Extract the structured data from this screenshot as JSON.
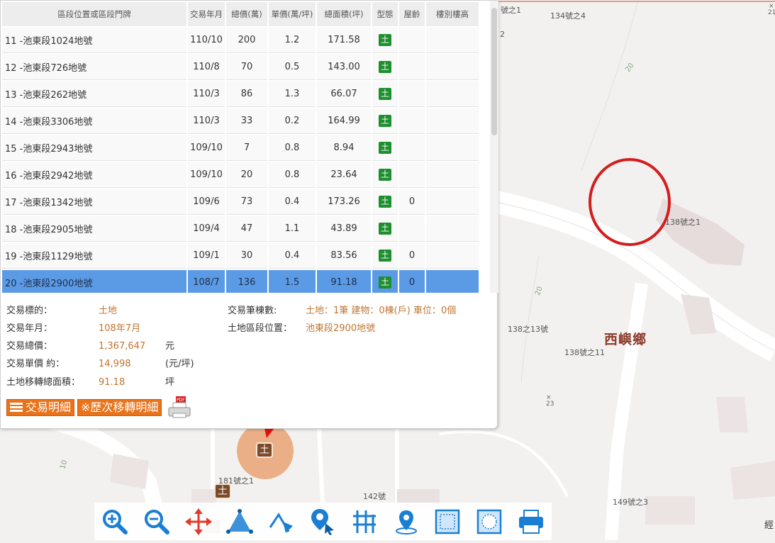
{
  "columns": {
    "address": "區段位置或區段門牌",
    "date": "交易年月",
    "total": "總價(萬)",
    "unit": "單價(萬/坪)",
    "area": "總面積(坪)",
    "type": "型態",
    "age": "屋齡",
    "floor": "樓別樓高"
  },
  "rows": [
    {
      "address": "11 -池東段1024地號",
      "date": "110/10",
      "total": "200",
      "unit": "1.2",
      "area": "171.58",
      "type": "土",
      "age": ""
    },
    {
      "address": "12 -池東段726地號",
      "date": "110/8",
      "total": "70",
      "unit": "0.5",
      "area": "143.00",
      "type": "土",
      "age": ""
    },
    {
      "address": "13 -池東段262地號",
      "date": "110/3",
      "total": "86",
      "unit": "1.3",
      "area": "66.07",
      "type": "土",
      "age": ""
    },
    {
      "address": "14 -池東段3306地號",
      "date": "110/3",
      "total": "33",
      "unit": "0.2",
      "area": "164.99",
      "type": "土",
      "age": ""
    },
    {
      "address": "15 -池東段2943地號",
      "date": "109/10",
      "total": "7",
      "unit": "0.8",
      "area": "8.94",
      "type": "土",
      "age": ""
    },
    {
      "address": "16 -池東段2942地號",
      "date": "109/10",
      "total": "20",
      "unit": "0.8",
      "area": "23.64",
      "type": "土",
      "age": ""
    },
    {
      "address": "17 -池東段1342地號",
      "date": "109/6",
      "total": "73",
      "unit": "0.4",
      "area": "173.26",
      "type": "土",
      "age": "0"
    },
    {
      "address": "18 -池東段2905地號",
      "date": "109/4",
      "total": "47",
      "unit": "1.1",
      "area": "43.89",
      "type": "土",
      "age": ""
    },
    {
      "address": "19 -池東段1129地號",
      "date": "109/1",
      "total": "30",
      "unit": "0.4",
      "area": "83.56",
      "type": "土",
      "age": "0"
    },
    {
      "address": "20 -池東段2900地號",
      "date": "108/7",
      "total": "136",
      "unit": "1.5",
      "area": "91.18",
      "type": "土",
      "age": "0"
    }
  ],
  "detail": {
    "target_label": "交易標的：",
    "target_value": "土地",
    "date_label": "交易年月：",
    "date_value": "108年7月",
    "total_label": "交易總價：",
    "total_value": "1,367,647",
    "total_unit": "元",
    "unit_label": "交易單價 約：",
    "unit_value": "14,998",
    "unit_unit": "(元/坪)",
    "area_label": "土地移轉總面積：",
    "area_value": "91.18",
    "area_unit": "坪",
    "count_label": "交易筆棟數:",
    "count_value": "土地：1筆 建物：0棟(戶) 車位：0個",
    "location_label": "土地區段位置：",
    "location_value": "池東段2900地號"
  },
  "actions": {
    "detail_button": "交易明細",
    "history_button": "※歷次移轉明細",
    "pdf_label": "PDF"
  },
  "map_labels": {
    "l1": "號之1",
    "l2": "134號之4",
    "l3": "138號之1",
    "l4": "138之13號",
    "l5": "西嶼鄉",
    "l6": "138號之11",
    "l7": "181號之1",
    "l8": "142號",
    "l9": "149號之3",
    "r1": "20",
    "r2": "20",
    "r3": "10",
    "h1": "23",
    "h2": "21",
    "side": "2",
    "edge": "經"
  },
  "colors": {
    "selected_row": "#5b9be6",
    "accent_orange": "#e8731a",
    "land_badge": "#1e8f2e",
    "value_text": "#c07530",
    "highlight_circle": "#d41d1d",
    "arrow": "#e3120b"
  }
}
